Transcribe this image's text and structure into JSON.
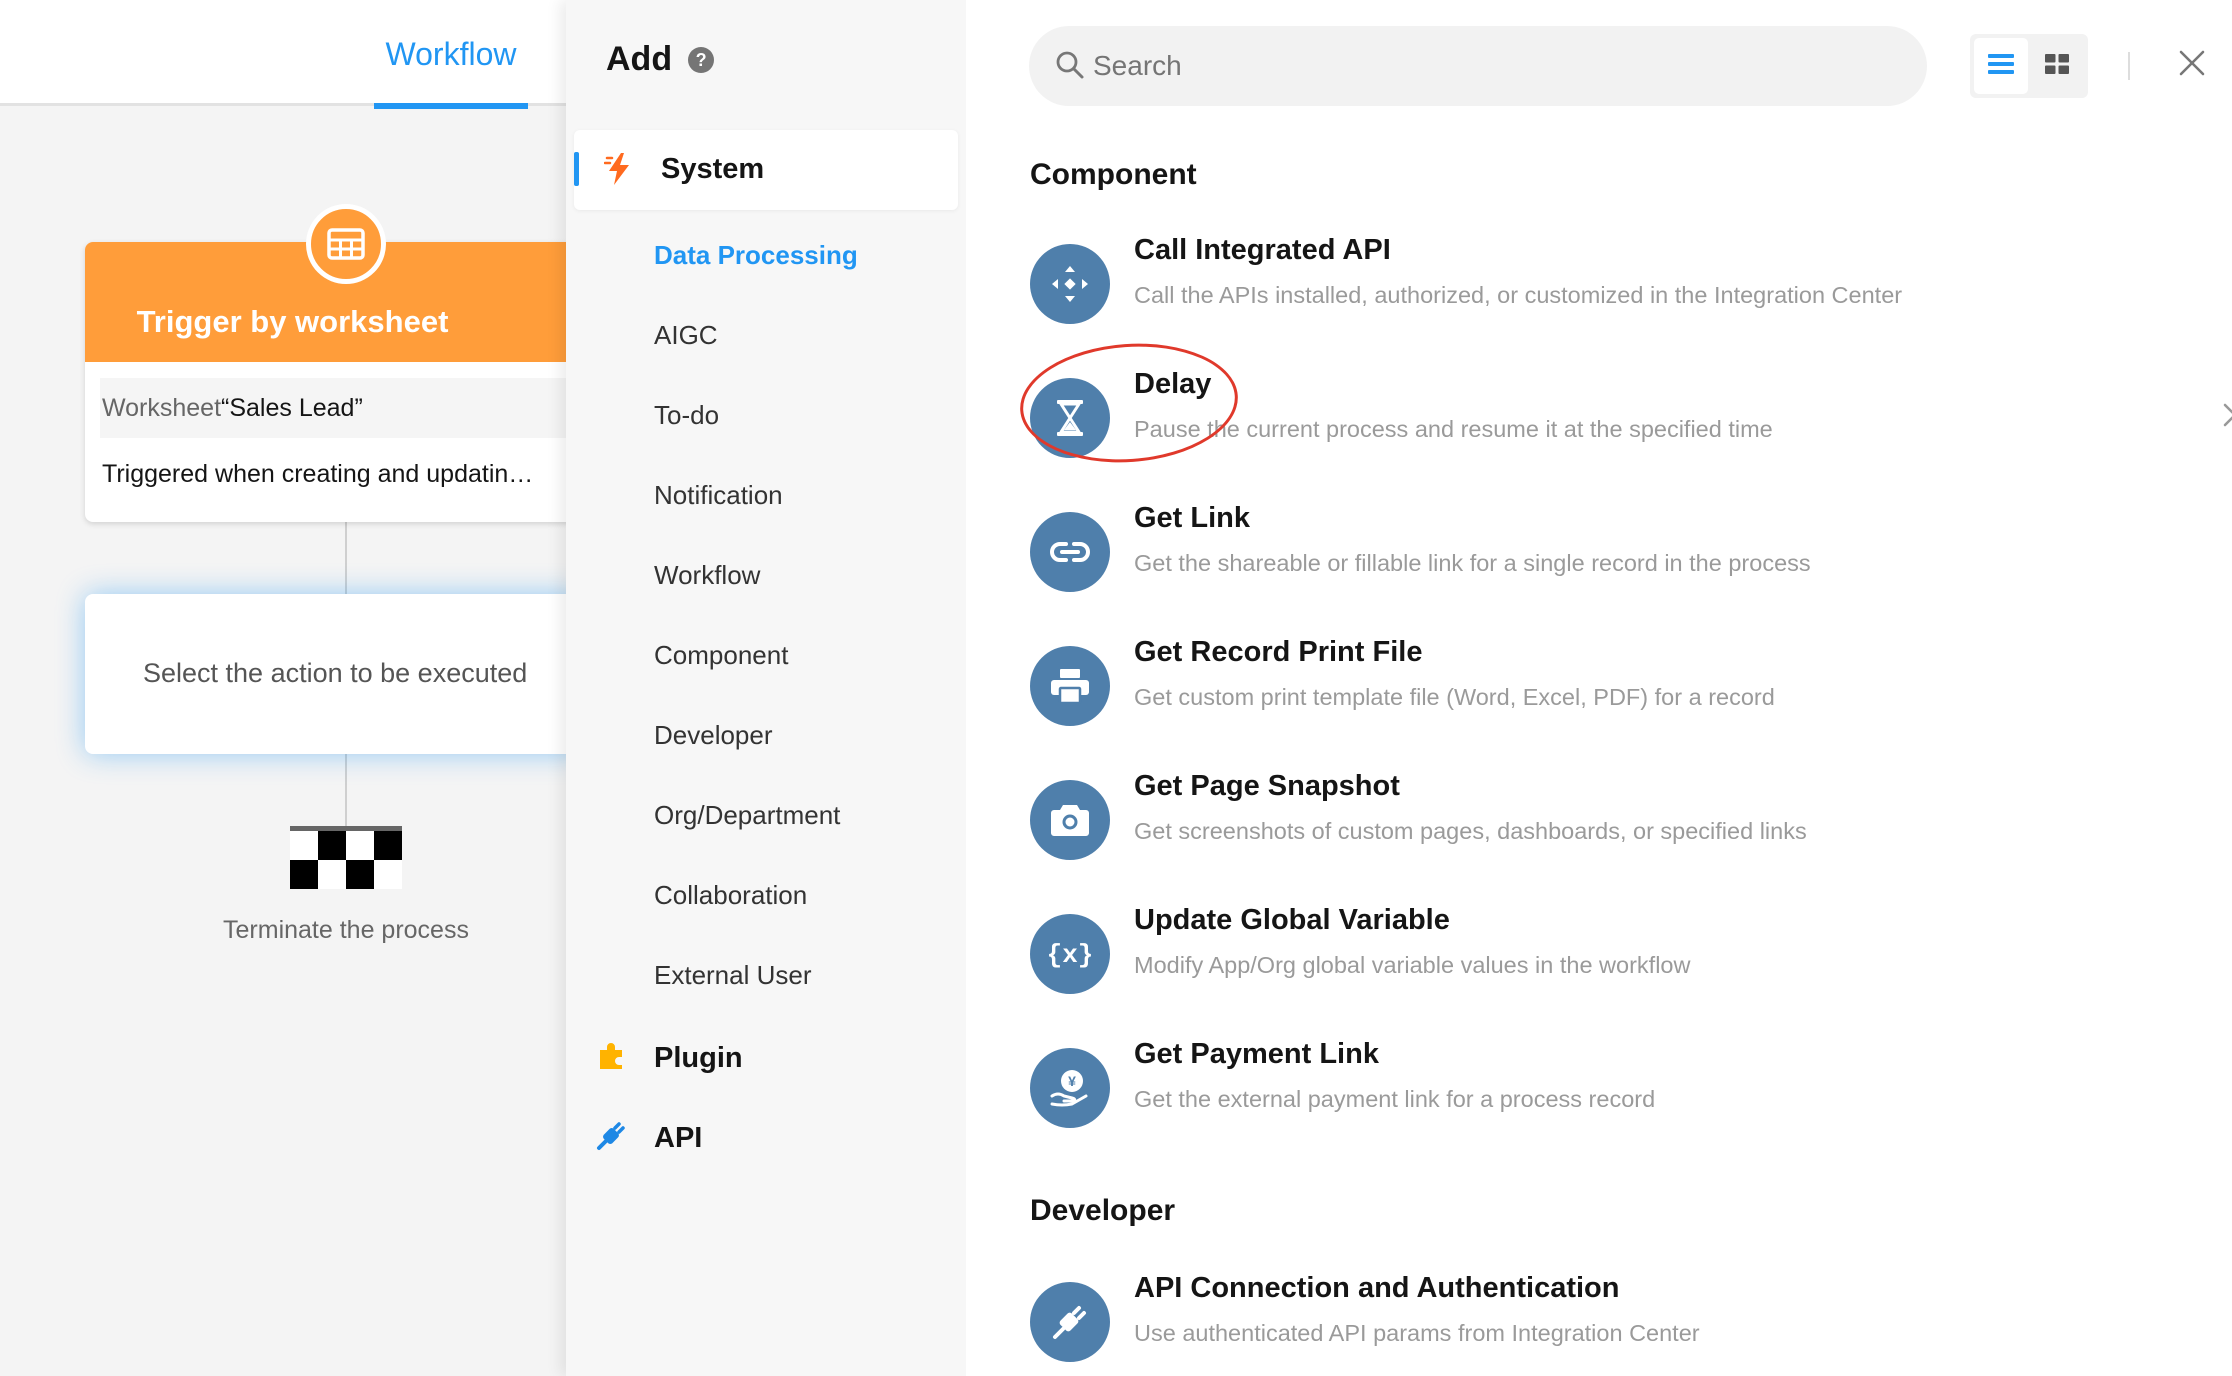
{
  "canvas": {
    "tab_label": "Workflow",
    "trigger": {
      "title": "Trigger by worksheet",
      "worksheet_prefix": "Worksheet",
      "worksheet_name": "“Sales Lead”",
      "description": "Triggered when creating and updatin…",
      "icon": "table-icon"
    },
    "action_placeholder": "Select the action to be executed",
    "finish_label": "Terminate the process",
    "colors": {
      "trigger": "#ff9d3a",
      "accent": "#2196f3"
    }
  },
  "categories": {
    "title": "Add",
    "system_label": "System",
    "sub_items": [
      "Data Processing",
      "AIGC",
      "To-do",
      "Notification",
      "Workflow",
      "Component",
      "Developer",
      "Org/Department",
      "Collaboration",
      "External User"
    ],
    "active_sub": "Data Processing",
    "plugin_label": "Plugin",
    "api_label": "API"
  },
  "search": {
    "placeholder": "Search",
    "value": ""
  },
  "sections": [
    {
      "title": "Component",
      "items": [
        {
          "name": "Call Integrated API",
          "desc": "Call the APIs installed, authorized, or customized in the Integration Center",
          "icon": "api-integration-icon"
        },
        {
          "name": "Delay",
          "desc": "Pause the current process and resume it at the specified time",
          "icon": "hourglass-icon",
          "highlighted": true,
          "has_chevron": true
        },
        {
          "name": "Get Link",
          "desc": "Get the shareable or fillable link for a single record in the process",
          "icon": "link-icon"
        },
        {
          "name": "Get Record Print File",
          "desc": "Get custom print template file (Word, Excel, PDF) for a record",
          "icon": "printer-icon"
        },
        {
          "name": "Get Page Snapshot",
          "desc": "Get screenshots of custom pages, dashboards, or specified links",
          "icon": "camera-icon"
        },
        {
          "name": "Update Global Variable",
          "desc": "Modify App/Org global variable values in the workflow",
          "icon": "variable-icon"
        },
        {
          "name": "Get Payment Link",
          "desc": "Get the external payment link for a process record",
          "icon": "payment-icon"
        }
      ]
    },
    {
      "title": "Developer",
      "items": [
        {
          "name": "API Connection and Authentication",
          "desc": "Use authenticated API params from Integration Center",
          "icon": "plug-icon"
        }
      ]
    }
  ],
  "colors": {
    "item_icon_bg": "#4f7fab",
    "highlight_ring": "#e0392b"
  }
}
